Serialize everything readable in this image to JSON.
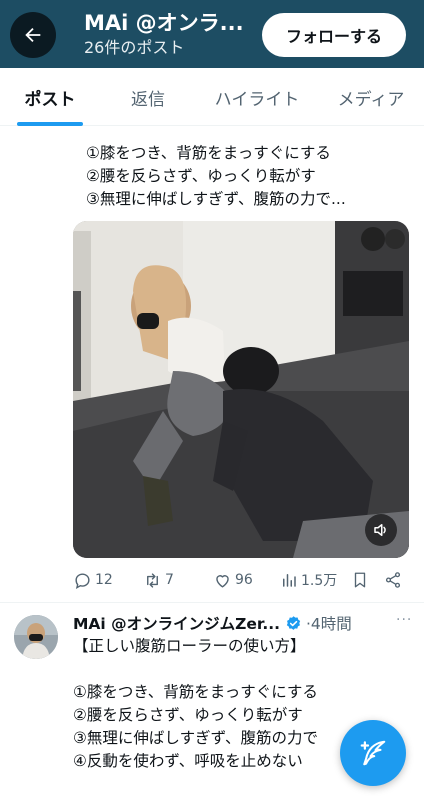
{
  "header": {
    "title": "MAi @オンラ...",
    "post_count": "26件のポスト",
    "follow_label": "フォローする"
  },
  "tabs": [
    {
      "label": "ポスト",
      "active": true
    },
    {
      "label": "返信",
      "active": false
    },
    {
      "label": "ハイライト",
      "active": false
    },
    {
      "label": "メディア",
      "active": false
    }
  ],
  "post1": {
    "lines": [
      "①膝をつき、背筋をまっすぐにする",
      "②腰を反らさず、ゆっくり転がす",
      "③無理に伸ばしすぎず、腹筋の力で..."
    ],
    "media_icon": "speaker-icon",
    "stats": {
      "replies": "12",
      "reposts": "7",
      "likes": "96",
      "views": "1.5万"
    }
  },
  "post2": {
    "author": "MAi @オンラインジムZer...",
    "time": "4時間",
    "more": "···",
    "lines": [
      "【正しい腹筋ローラーの使い方】",
      "",
      "①膝をつき、背筋をまっすぐにする",
      "②腰を反らさず、ゆっくり転がす",
      "③無理に伸ばしすぎず、腹筋の力で",
      "④反動を使わず、呼吸を止めない"
    ]
  },
  "colors": {
    "header_bg": "#1d4d63",
    "accent": "#1d9bf0",
    "muted": "#536471"
  }
}
